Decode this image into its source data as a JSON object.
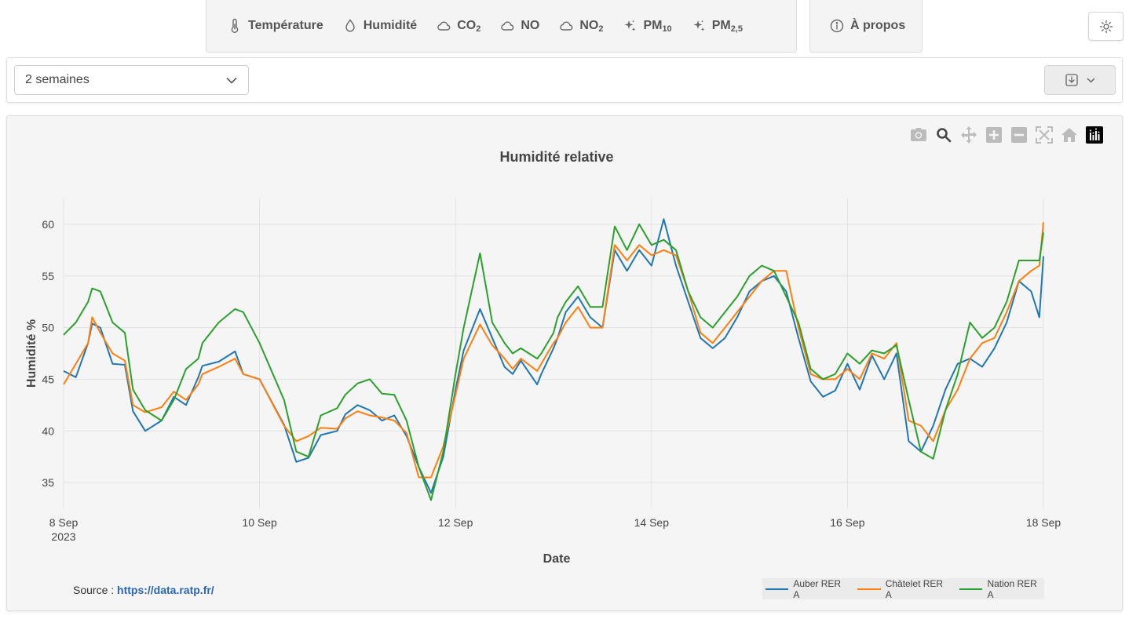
{
  "nav": {
    "tabs": [
      {
        "label": "Température",
        "icon": "thermometer-icon"
      },
      {
        "label": "Humidité",
        "icon": "droplet-icon"
      },
      {
        "label": "CO",
        "sub": "2",
        "icon": "cloud-icon"
      },
      {
        "label": "NO",
        "sub": "",
        "icon": "cloud-icon"
      },
      {
        "label": "NO",
        "sub": "2",
        "icon": "cloud-icon"
      },
      {
        "label": "PM",
        "sub": "10",
        "icon": "sparkle-icon"
      },
      {
        "label": "PM",
        "sub": "2,5",
        "icon": "sparkle-icon"
      }
    ],
    "about": {
      "label": "À propos",
      "icon": "info-icon"
    },
    "theme_icon": "sun-icon"
  },
  "controls": {
    "period": "2 semaines",
    "download_icon": "download-icon"
  },
  "source": {
    "prefix": "Source : ",
    "link": "https://data.ratp.fr/"
  },
  "colors": {
    "auber": "#1f77b4",
    "chatelet": "#ff7f0e",
    "nation": "#2ca02c"
  },
  "chart_data": {
    "type": "line",
    "title": "Humidité relative",
    "xlabel": "Date",
    "ylabel": "Humidité %",
    "x_ticks": [
      {
        "date": "2023-09-08",
        "label": "8 Sep",
        "sub": "2023"
      },
      {
        "date": "2023-09-10",
        "label": "10 Sep"
      },
      {
        "date": "2023-09-12",
        "label": "12 Sep"
      },
      {
        "date": "2023-09-14",
        "label": "14 Sep"
      },
      {
        "date": "2023-09-16",
        "label": "16 Sep"
      },
      {
        "date": "2023-09-18",
        "label": "18 Sep"
      }
    ],
    "xlim": [
      "2023-09-08",
      "2023-09-18"
    ],
    "y_ticks": [
      35,
      40,
      45,
      50,
      55,
      60
    ],
    "ylim": [
      32.5,
      62.5
    ],
    "grid": true,
    "legend": "bottom-right",
    "series": [
      {
        "name": "Auber RER A",
        "color": "#1f77b4",
        "x": [
          "2023-09-08 00:00",
          "2023-09-08 03:00",
          "2023-09-08 06:00",
          "2023-09-08 07:00",
          "2023-09-08 09:00",
          "2023-09-08 12:00",
          "2023-09-08 15:00",
          "2023-09-08 17:00",
          "2023-09-08 20:00",
          "2023-09-09 00:00",
          "2023-09-09 03:00",
          "2023-09-09 06:00",
          "2023-09-09 09:00",
          "2023-09-09 10:00",
          "2023-09-09 14:00",
          "2023-09-09 18:00",
          "2023-09-09 20:00",
          "2023-09-10 00:00",
          "2023-09-10 06:00",
          "2023-09-10 09:00",
          "2023-09-10 12:00",
          "2023-09-10 15:00",
          "2023-09-10 19:00",
          "2023-09-10 21:00",
          "2023-09-11 00:00",
          "2023-09-11 03:00",
          "2023-09-11 06:00",
          "2023-09-11 09:00",
          "2023-09-11 12:00",
          "2023-09-11 15:00",
          "2023-09-11 18:00",
          "2023-09-11 21:00",
          "2023-09-12 00:00",
          "2023-09-12 02:00",
          "2023-09-12 06:00",
          "2023-09-12 09:00",
          "2023-09-12 12:00",
          "2023-09-12 14:00",
          "2023-09-12 16:00",
          "2023-09-12 20:00",
          "2023-09-12 21:00",
          "2023-09-13 00:00",
          "2023-09-13 01:00",
          "2023-09-13 03:00",
          "2023-09-13 06:00",
          "2023-09-13 09:00",
          "2023-09-13 12:00",
          "2023-09-13 15:00",
          "2023-09-13 18:00",
          "2023-09-13 21:00",
          "2023-09-14 00:00",
          "2023-09-14 03:00",
          "2023-09-14 06:00",
          "2023-09-14 09:00",
          "2023-09-14 12:00",
          "2023-09-14 15:00",
          "2023-09-14 18:00",
          "2023-09-14 21:00",
          "2023-09-15 00:00",
          "2023-09-15 03:00",
          "2023-09-15 06:00",
          "2023-09-15 09:00",
          "2023-09-15 12:00",
          "2023-09-15 15:00",
          "2023-09-15 18:00",
          "2023-09-15 21:00",
          "2023-09-16 00:00",
          "2023-09-16 03:00",
          "2023-09-16 06:00",
          "2023-09-16 09:00",
          "2023-09-16 12:00",
          "2023-09-16 15:00",
          "2023-09-16 18:00",
          "2023-09-16 21:00",
          "2023-09-17 00:00",
          "2023-09-17 03:00",
          "2023-09-17 06:00",
          "2023-09-17 09:00",
          "2023-09-17 12:00",
          "2023-09-17 15:00",
          "2023-09-17 18:00",
          "2023-09-17 21:00",
          "2023-09-17 23:00",
          "2023-09-18 00:00"
        ],
        "values": [
          45.8,
          45.2,
          48.5,
          50.4,
          50.0,
          46.5,
          46.4,
          41.9,
          40.0,
          41.0,
          43.3,
          42.5,
          45.2,
          46.3,
          46.7,
          47.7,
          45.5,
          45.0,
          40.6,
          37.0,
          37.4,
          39.6,
          40.0,
          41.6,
          42.5,
          42.0,
          41.0,
          41.5,
          39.5,
          36.5,
          34.0,
          37.5,
          44.0,
          47.8,
          51.8,
          49.0,
          46.2,
          45.5,
          46.8,
          44.5,
          45.5,
          48.0,
          49.0,
          51.5,
          53.0,
          51.0,
          50.0,
          57.5,
          55.5,
          57.5,
          56.0,
          60.5,
          56.0,
          52.5,
          49.0,
          48.0,
          49.0,
          51.0,
          53.5,
          54.5,
          55.0,
          53.5,
          49.0,
          44.8,
          43.3,
          43.9,
          46.5,
          44.0,
          47.3,
          45.0,
          47.5,
          39.0,
          38.0,
          40.5,
          44.0,
          46.5,
          47.0,
          46.2,
          48.0,
          50.5,
          54.5,
          53.5,
          51.0,
          56.9
        ]
      },
      {
        "name": "Châtelet RER A",
        "color": "#ff7f0e",
        "x": [
          "2023-09-08 00:00",
          "2023-09-08 03:00",
          "2023-09-08 06:00",
          "2023-09-08 07:00",
          "2023-09-08 09:00",
          "2023-09-08 12:00",
          "2023-09-08 15:00",
          "2023-09-08 17:00",
          "2023-09-08 20:00",
          "2023-09-09 00:00",
          "2023-09-09 03:00",
          "2023-09-09 06:00",
          "2023-09-09 09:00",
          "2023-09-09 10:00",
          "2023-09-09 14:00",
          "2023-09-09 18:00",
          "2023-09-09 20:00",
          "2023-09-10 00:00",
          "2023-09-10 06:00",
          "2023-09-10 09:00",
          "2023-09-10 12:00",
          "2023-09-10 15:00",
          "2023-09-10 19:00",
          "2023-09-10 21:00",
          "2023-09-11 00:00",
          "2023-09-11 03:00",
          "2023-09-11 06:00",
          "2023-09-11 09:00",
          "2023-09-11 12:00",
          "2023-09-11 15:00",
          "2023-09-11 18:00",
          "2023-09-11 21:00",
          "2023-09-12 00:00",
          "2023-09-12 02:00",
          "2023-09-12 06:00",
          "2023-09-12 09:00",
          "2023-09-12 12:00",
          "2023-09-12 14:00",
          "2023-09-12 16:00",
          "2023-09-12 20:00",
          "2023-09-12 21:00",
          "2023-09-13 00:00",
          "2023-09-13 01:00",
          "2023-09-13 03:00",
          "2023-09-13 06:00",
          "2023-09-13 09:00",
          "2023-09-13 12:00",
          "2023-09-13 15:00",
          "2023-09-13 18:00",
          "2023-09-13 21:00",
          "2023-09-14 00:00",
          "2023-09-14 03:00",
          "2023-09-14 06:00",
          "2023-09-14 09:00",
          "2023-09-14 12:00",
          "2023-09-14 15:00",
          "2023-09-14 18:00",
          "2023-09-14 21:00",
          "2023-09-15 00:00",
          "2023-09-15 03:00",
          "2023-09-15 06:00",
          "2023-09-15 09:00",
          "2023-09-15 12:00",
          "2023-09-15 15:00",
          "2023-09-15 18:00",
          "2023-09-15 21:00",
          "2023-09-16 00:00",
          "2023-09-16 03:00",
          "2023-09-16 06:00",
          "2023-09-16 09:00",
          "2023-09-16 12:00",
          "2023-09-16 15:00",
          "2023-09-16 18:00",
          "2023-09-16 21:00",
          "2023-09-17 00:00",
          "2023-09-17 03:00",
          "2023-09-17 06:00",
          "2023-09-17 09:00",
          "2023-09-17 12:00",
          "2023-09-17 15:00",
          "2023-09-17 18:00",
          "2023-09-17 21:00",
          "2023-09-17 23:00",
          "2023-09-18 00:00"
        ],
        "values": [
          44.5,
          46.5,
          48.5,
          51.0,
          49.5,
          47.5,
          46.8,
          42.5,
          41.8,
          42.3,
          43.8,
          43.0,
          44.5,
          45.5,
          46.2,
          47.0,
          45.5,
          45.0,
          40.5,
          39.0,
          39.5,
          40.3,
          40.2,
          41.2,
          41.9,
          41.5,
          41.3,
          41.0,
          39.8,
          35.5,
          35.5,
          38.5,
          43.5,
          47.0,
          50.3,
          48.3,
          47.0,
          46.0,
          47.0,
          45.8,
          46.5,
          48.5,
          49.0,
          50.5,
          52.0,
          50.0,
          50.0,
          58.0,
          56.5,
          58.0,
          57.0,
          57.5,
          57.0,
          53.5,
          49.5,
          48.5,
          50.0,
          51.5,
          53.0,
          54.5,
          55.5,
          55.5,
          50.0,
          45.5,
          45.0,
          45.0,
          46.0,
          45.0,
          47.5,
          47.0,
          48.5,
          41.0,
          40.5,
          39.0,
          42.0,
          44.0,
          47.0,
          48.5,
          49.0,
          51.5,
          54.5,
          55.5,
          56.0,
          60.2
        ]
      },
      {
        "name": "Nation RER A",
        "color": "#2ca02c",
        "x": [
          "2023-09-08 00:00",
          "2023-09-08 03:00",
          "2023-09-08 06:00",
          "2023-09-08 07:00",
          "2023-09-08 09:00",
          "2023-09-08 12:00",
          "2023-09-08 15:00",
          "2023-09-08 17:00",
          "2023-09-08 20:00",
          "2023-09-09 00:00",
          "2023-09-09 03:00",
          "2023-09-09 06:00",
          "2023-09-09 09:00",
          "2023-09-09 10:00",
          "2023-09-09 14:00",
          "2023-09-09 18:00",
          "2023-09-09 20:00",
          "2023-09-10 00:00",
          "2023-09-10 06:00",
          "2023-09-10 09:00",
          "2023-09-10 12:00",
          "2023-09-10 15:00",
          "2023-09-10 19:00",
          "2023-09-10 21:00",
          "2023-09-11 00:00",
          "2023-09-11 03:00",
          "2023-09-11 06:00",
          "2023-09-11 09:00",
          "2023-09-11 12:00",
          "2023-09-11 15:00",
          "2023-09-11 18:00",
          "2023-09-11 21:00",
          "2023-09-12 00:00",
          "2023-09-12 02:00",
          "2023-09-12 06:00",
          "2023-09-12 09:00",
          "2023-09-12 12:00",
          "2023-09-12 14:00",
          "2023-09-12 16:00",
          "2023-09-12 20:00",
          "2023-09-12 21:00",
          "2023-09-13 00:00",
          "2023-09-13 01:00",
          "2023-09-13 03:00",
          "2023-09-13 06:00",
          "2023-09-13 09:00",
          "2023-09-13 12:00",
          "2023-09-13 15:00",
          "2023-09-13 18:00",
          "2023-09-13 21:00",
          "2023-09-14 00:00",
          "2023-09-14 03:00",
          "2023-09-14 06:00",
          "2023-09-14 09:00",
          "2023-09-14 12:00",
          "2023-09-14 15:00",
          "2023-09-14 18:00",
          "2023-09-14 21:00",
          "2023-09-15 00:00",
          "2023-09-15 03:00",
          "2023-09-15 06:00",
          "2023-09-15 09:00",
          "2023-09-15 12:00",
          "2023-09-15 15:00",
          "2023-09-15 18:00",
          "2023-09-15 21:00",
          "2023-09-16 00:00",
          "2023-09-16 03:00",
          "2023-09-16 06:00",
          "2023-09-16 09:00",
          "2023-09-16 12:00",
          "2023-09-16 15:00",
          "2023-09-16 18:00",
          "2023-09-16 21:00",
          "2023-09-17 00:00",
          "2023-09-17 03:00",
          "2023-09-17 06:00",
          "2023-09-17 09:00",
          "2023-09-17 12:00",
          "2023-09-17 15:00",
          "2023-09-17 18:00",
          "2023-09-17 21:00",
          "2023-09-17 23:00",
          "2023-09-18 00:00"
        ],
        "values": [
          49.3,
          50.5,
          52.5,
          53.8,
          53.5,
          50.5,
          49.5,
          44.0,
          42.0,
          41.0,
          43.0,
          46.0,
          47.0,
          48.5,
          50.5,
          51.8,
          51.5,
          48.5,
          43.0,
          38.0,
          37.5,
          41.5,
          42.2,
          43.5,
          44.6,
          45.0,
          43.6,
          43.5,
          41.0,
          36.5,
          33.3,
          38.0,
          45.5,
          50.0,
          57.2,
          50.5,
          48.5,
          47.5,
          48.0,
          47.0,
          47.5,
          49.5,
          51.0,
          52.5,
          54.0,
          52.0,
          52.0,
          59.8,
          57.5,
          60.0,
          58.0,
          58.5,
          57.5,
          53.5,
          51.0,
          50.0,
          51.5,
          53.0,
          55.0,
          56.0,
          55.5,
          53.0,
          50.5,
          46.0,
          45.0,
          45.5,
          47.5,
          46.5,
          47.8,
          47.5,
          48.3,
          43.0,
          38.0,
          37.3,
          42.0,
          45.5,
          50.5,
          49.0,
          50.0,
          52.5,
          56.5,
          56.5,
          56.5,
          59.2
        ]
      }
    ]
  },
  "modebar": [
    "camera-icon",
    "zoom-icon",
    "pan-icon",
    "zoom-in-icon",
    "zoom-out-icon",
    "autoscale-icon",
    "reset-axes-icon",
    "plotly-logo-icon"
  ]
}
